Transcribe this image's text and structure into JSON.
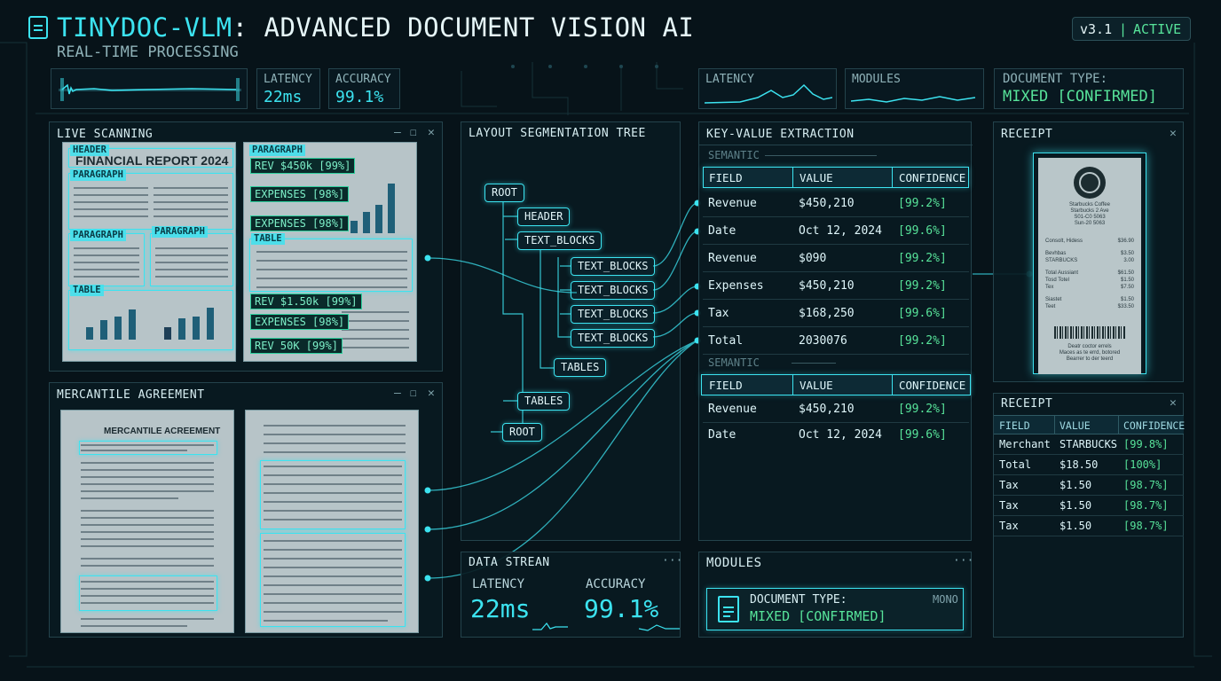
{
  "header": {
    "title": "TINYDOC-VLM",
    "title_rest": ": ADVANCED DOCUMENT VISION AI",
    "subtitle": "REAL-TIME PROCESSING",
    "version": "v3.1",
    "status": "ACTIVE",
    "separator": "|"
  },
  "top_stats": {
    "latency_label": "LATENCY",
    "latency_value": "22ms",
    "accuracy_label": "ACCURACY",
    "accuracy_value": "99.1%",
    "latency2_label": "LATENCY",
    "modules_label": "MODULES",
    "doctype_label": "DOCUMENT TYPE:",
    "doctype_value": "MIXED [CONFIRMED]"
  },
  "live_scanning": {
    "title": "LIVE SCANNING",
    "left_page": {
      "header_tag": "HEADER",
      "doc_title": "FINANCIAL REPORT 2024",
      "tags": [
        "PARAGRAPH",
        "PARAGRAPH",
        "PARAGRAPH",
        "TABLE"
      ]
    },
    "right_page": {
      "paragraph_tag": "PARAGRAPH",
      "table_tag": "TABLE",
      "labels": [
        "REV $450k [99%]",
        "EXPENSES [98%]",
        "EXPENSES [98%]",
        "REV $1.50k [99%]",
        "EXPENSES [98%]",
        "REV 50K [99%]"
      ]
    }
  },
  "agreement": {
    "title": "MERCANTILE AGREEMENT",
    "doc_title": "MERCANTILE ACREEMENT"
  },
  "tree": {
    "title": "LAYOUT SEGMENTATION TREE",
    "nodes": [
      "ROOT",
      "HEADER",
      "TEXT_BLOCKS",
      "TEXT_BLOCKS",
      "TEXT_BLOCKS",
      "TEXT_BLOCKS",
      "TEXT_BLOCKS",
      "TABLES",
      "TABLES",
      "ROOT"
    ]
  },
  "kv": {
    "title": "KEY-VALUE EXTRACTION",
    "semantic_label": "SEMANTIC",
    "columns": [
      "FIELD",
      "VALUE",
      "CONFIDENCE"
    ],
    "rows": [
      {
        "field": "Revenue",
        "value": "$450,210",
        "conf": "[99.2%]"
      },
      {
        "field": "Date",
        "value": "Oct 12, 2024",
        "conf": "[99.6%]"
      },
      {
        "field": "Revenue",
        "value": "$090",
        "conf": "[99.2%]"
      },
      {
        "field": "Expenses",
        "value": "$450,210",
        "conf": "[99.2%]"
      },
      {
        "field": "Tax",
        "value": "$168,250",
        "conf": "[99.6%]"
      },
      {
        "field": "Total",
        "value": "2030076",
        "conf": "[99.2%]"
      }
    ],
    "semantic_label2": "SEMANTIC",
    "rows2": [
      {
        "field": "Revenue",
        "value": "$450,210",
        "conf": "[99.2%]"
      },
      {
        "field": "Date",
        "value": "Oct 12, 2024",
        "conf": "[99.6%]"
      }
    ]
  },
  "receipt_preview": {
    "title": "RECEIPT",
    "header_lines": [
      "Starbucks Coffee",
      "Starbucks 2 Ave",
      "S01-C0 5063",
      "Sun-20 5063"
    ],
    "items": [
      {
        "name": "Consolt, Hidess",
        "price": "$36.90"
      },
      {
        "name": "Bevhbas",
        "price": "$3.50"
      },
      {
        "name": "STARBUCKS",
        "price": "3.00"
      },
      {
        "name": "Total Aussiant",
        "price": "$61.50"
      },
      {
        "name": "Tosd Totel",
        "price": "$1.50"
      },
      {
        "name": "Tex",
        "price": "$7.50"
      },
      {
        "name": "Siastet",
        "price": "$1.50"
      },
      {
        "name": "Teet",
        "price": "$33.50"
      }
    ],
    "footer_lines": [
      "Deatr coctor errels",
      "Maces as te errd, botored",
      "Bearrer to der teerd"
    ]
  },
  "receipt_table": {
    "title": "RECEIPT",
    "columns": [
      "FIELD",
      "VALUE",
      "CONFIDENCE"
    ],
    "rows": [
      {
        "field": "Merchant",
        "value": "STARBUCKS",
        "conf": "[99.8%]"
      },
      {
        "field": "Total",
        "value": "$18.50",
        "conf": "[100%]"
      },
      {
        "field": "Tax",
        "value": "$1.50",
        "conf": "[98.7%]"
      },
      {
        "field": "Tax",
        "value": "$1.50",
        "conf": "[98.7%]"
      },
      {
        "field": "Tax",
        "value": "$1.50",
        "conf": "[98.7%]"
      }
    ]
  },
  "data_stream": {
    "title": "DATA STREAN",
    "more": "···",
    "latency_label": "LATENCY",
    "latency_value": "22ms",
    "accuracy_label": "ACCURACY",
    "accuracy_value": "99.1%"
  },
  "modules": {
    "title": "MODULES",
    "more": "···",
    "doctype_label": "DOCUMENT TYPE:",
    "doctype_value": "MIXED [CONFIRMED]",
    "mono": "MONO"
  },
  "window_controls": {
    "minimize": "—",
    "maximize": "☐",
    "close": "✕"
  },
  "colors": {
    "accent": "#3ce3f0",
    "confidence": "#57e39a",
    "background": "#071319"
  }
}
